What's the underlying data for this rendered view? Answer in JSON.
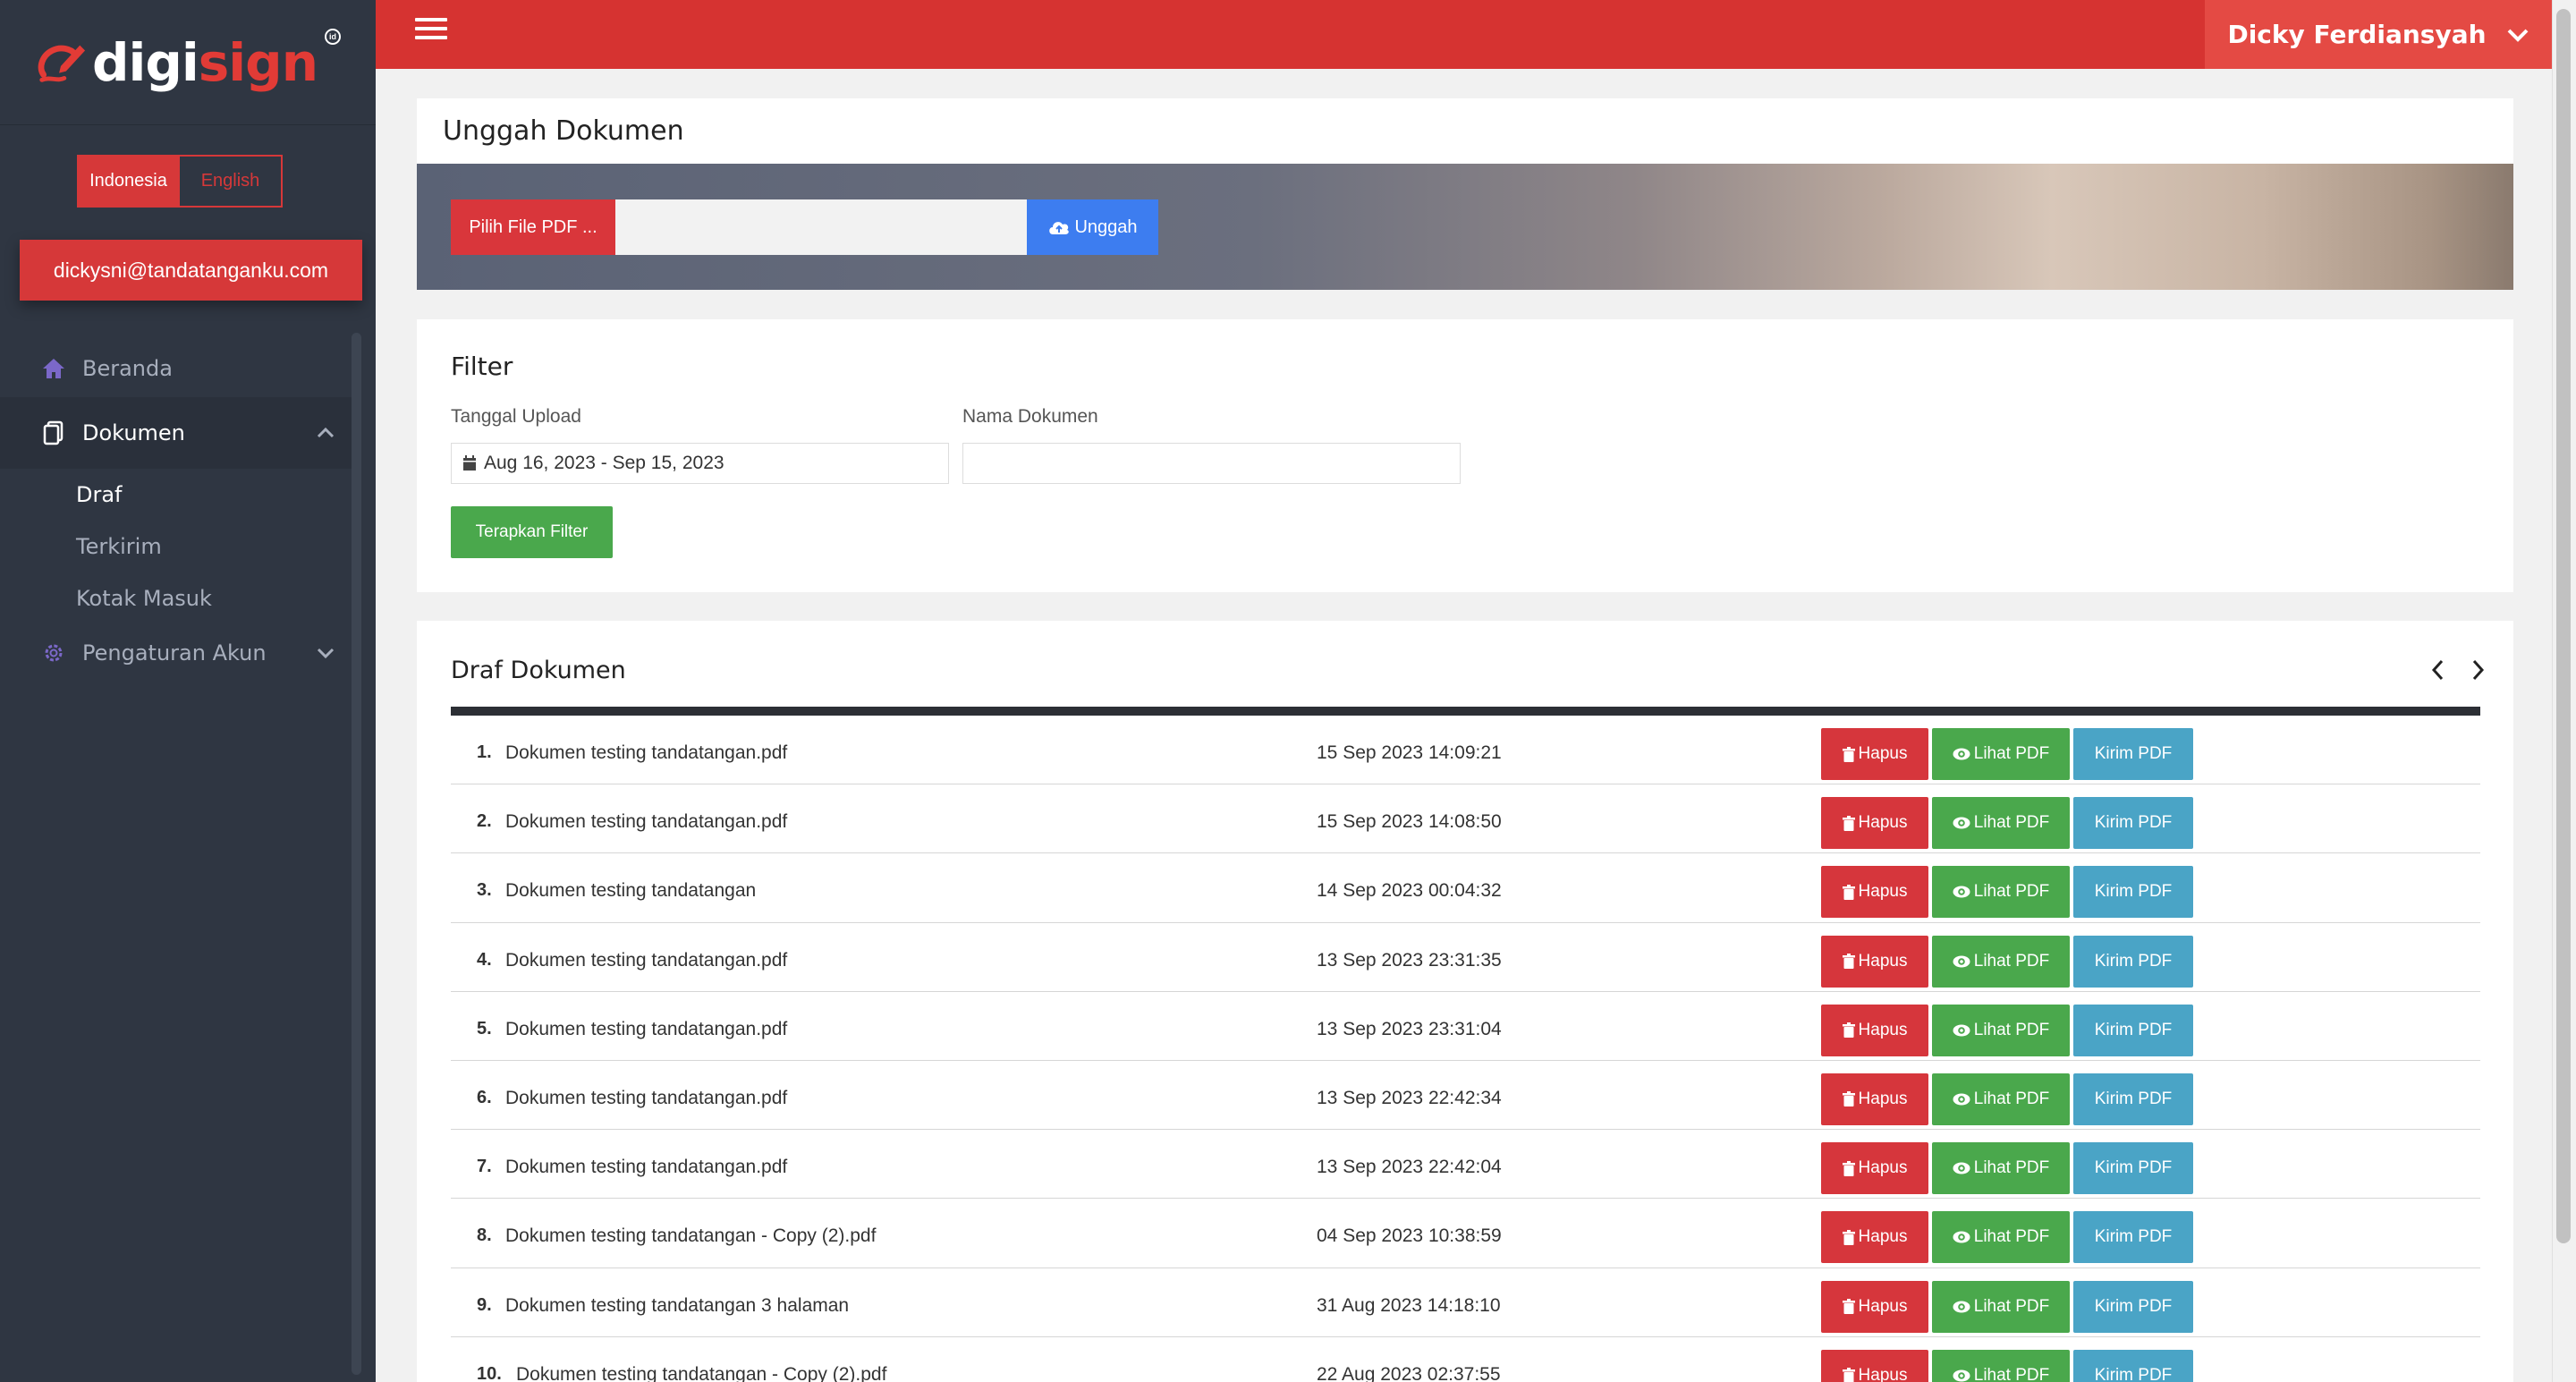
{
  "brand": {
    "logo_white": "digi",
    "logo_red": "sign",
    "logo_badge": "id"
  },
  "language": {
    "active": "Indonesia",
    "inactive": "English"
  },
  "user": {
    "email": "dickysni@tandatanganku.com",
    "name": "Dicky Ferdiansyah"
  },
  "sidebar": {
    "items": [
      {
        "label": "Beranda",
        "icon": "home-icon"
      },
      {
        "label": "Dokumen",
        "icon": "document-icon"
      },
      {
        "label": "Pengaturan Akun",
        "icon": "gear-icon"
      }
    ],
    "dokumen_sub": [
      "Draf",
      "Terkirim",
      "Kotak Masuk"
    ]
  },
  "upload": {
    "title": "Unggah Dokumen",
    "pick_label": "Pilih File PDF ...",
    "upload_label": "Unggah"
  },
  "filter": {
    "title": "Filter",
    "date_label": "Tanggal Upload",
    "date_value": "Aug 16, 2023 - Sep 15, 2023",
    "name_label": "Nama Dokumen",
    "name_value": "",
    "apply_label": "Terapkan Filter"
  },
  "drafts": {
    "title": "Draf Dokumen",
    "actions": {
      "delete": "Hapus",
      "view": "Lihat PDF",
      "send": "Kirim PDF"
    },
    "rows": [
      {
        "num": "1.",
        "name": "Dokumen testing tandatangan.pdf",
        "date": "15 Sep 2023 14:09:21"
      },
      {
        "num": "2.",
        "name": "Dokumen testing tandatangan.pdf",
        "date": "15 Sep 2023 14:08:50"
      },
      {
        "num": "3.",
        "name": "Dokumen testing tandatangan",
        "date": "14 Sep 2023 00:04:32"
      },
      {
        "num": "4.",
        "name": "Dokumen testing tandatangan.pdf",
        "date": "13 Sep 2023 23:31:35"
      },
      {
        "num": "5.",
        "name": "Dokumen testing tandatangan.pdf",
        "date": "13 Sep 2023 23:31:04"
      },
      {
        "num": "6.",
        "name": "Dokumen testing tandatangan.pdf",
        "date": "13 Sep 2023 22:42:34"
      },
      {
        "num": "7.",
        "name": "Dokumen testing tandatangan.pdf",
        "date": "13 Sep 2023 22:42:04"
      },
      {
        "num": "8.",
        "name": "Dokumen testing tandatangan - Copy (2).pdf",
        "date": "04 Sep 2023 10:38:59"
      },
      {
        "num": "9.",
        "name": "Dokumen testing tandatangan 3 halaman",
        "date": "31 Aug 2023 14:18:10"
      },
      {
        "num": "10.",
        "name": "Dokumen testing tandatangan - Copy (2).pdf",
        "date": "22 Aug 2023 02:37:55"
      }
    ]
  },
  "colors": {
    "brand_red": "#d63331",
    "sidebar": "#2f3642",
    "green": "#4aa84c",
    "blue": "#3d7df0",
    "teal": "#4aa4c6"
  }
}
